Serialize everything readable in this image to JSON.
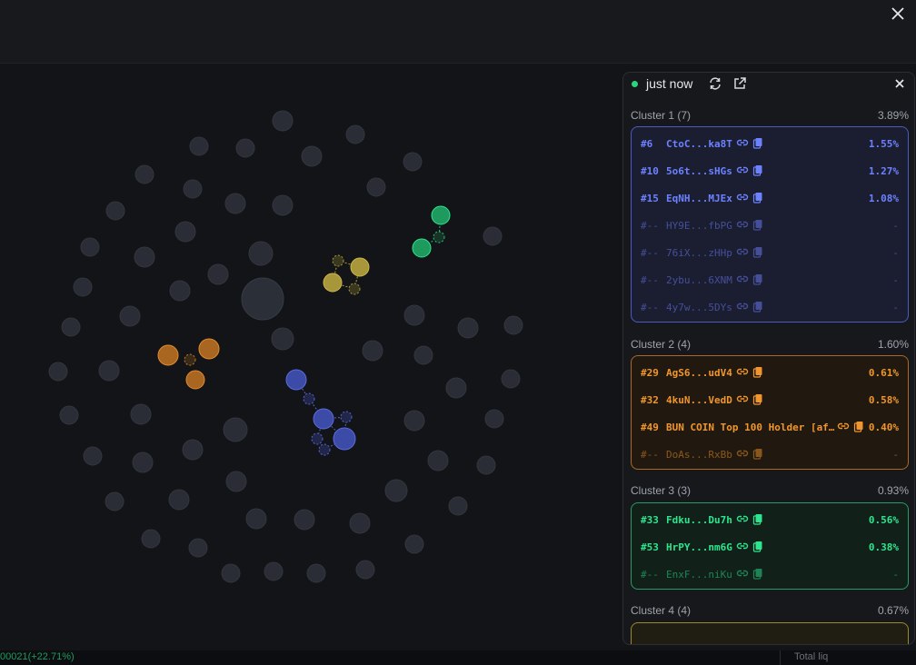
{
  "window": {
    "close_icon": "close-icon"
  },
  "ticker": {
    "text": "00021(+22.71%)",
    "total_liq_label": "Total liq"
  },
  "panel": {
    "updated_label": "just now",
    "icons": [
      "refresh-icon",
      "external-link-icon",
      "close-icon"
    ],
    "clusters": [
      {
        "name": "Cluster 1 (7)",
        "total": "3.89%",
        "color": "#6d82ff",
        "rows": [
          {
            "rank": "#6",
            "addr": "CtoC...ka8T",
            "value": "1.55%",
            "dim": false
          },
          {
            "rank": "#10",
            "addr": "5o6t...sHGs",
            "value": "1.27%",
            "dim": false
          },
          {
            "rank": "#15",
            "addr": "EqNH...MJEx",
            "value": "1.08%",
            "dim": false
          },
          {
            "rank": "#--",
            "addr": "HY9E...fbPG",
            "value": "-",
            "dim": true
          },
          {
            "rank": "#--",
            "addr": "76iX...zHHp",
            "value": "-",
            "dim": true
          },
          {
            "rank": "#--",
            "addr": "2ybu...6XNM",
            "value": "-",
            "dim": true
          },
          {
            "rank": "#--",
            "addr": "4y7w...5DYs",
            "value": "-",
            "dim": true
          }
        ]
      },
      {
        "name": "Cluster 2 (4)",
        "total": "1.60%",
        "color": "#f0962e",
        "rows": [
          {
            "rank": "#29",
            "addr": "AgS6...udV4",
            "value": "0.61%",
            "dim": false
          },
          {
            "rank": "#32",
            "addr": "4kuN...VedD",
            "value": "0.58%",
            "dim": false
          },
          {
            "rank": "#49",
            "addr": "BUN COIN Top 100 Holder [af…",
            "value": "0.40%",
            "dim": false
          },
          {
            "rank": "#--",
            "addr": "DoAs...RxBb",
            "value": "-",
            "dim": true
          }
        ]
      },
      {
        "name": "Cluster 3 (3)",
        "total": "0.93%",
        "color": "#2ee58f",
        "rows": [
          {
            "rank": "#33",
            "addr": "Fdku...Du7h",
            "value": "0.56%",
            "dim": false
          },
          {
            "rank": "#53",
            "addr": "HrPY...nm6G",
            "value": "0.38%",
            "dim": false
          },
          {
            "rank": "#--",
            "addr": "EnxF...niKu",
            "value": "-",
            "dim": true
          }
        ]
      },
      {
        "name": "Cluster 4 (4)",
        "total": "0.67%",
        "color": "#e2c94a",
        "rows": []
      }
    ]
  }
}
